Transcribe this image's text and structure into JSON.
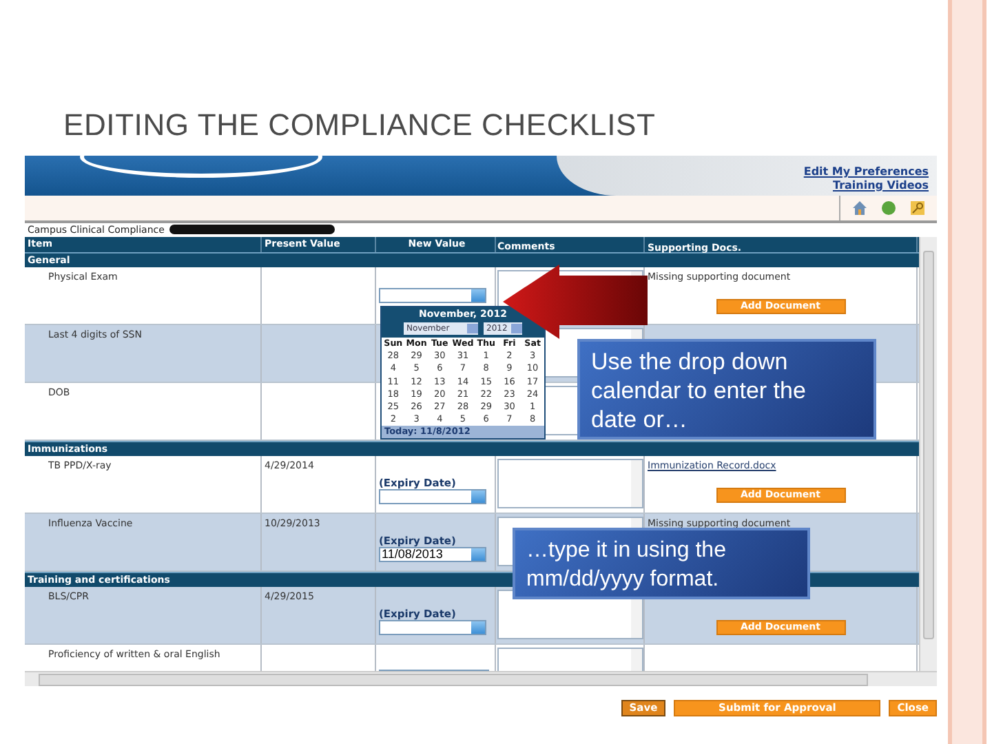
{
  "slide_title": "EDITING THE COMPLIANCE CHECKLIST",
  "header": {
    "links": [
      "Edit My Preferences",
      "Training Videos"
    ]
  },
  "breadcrumb": "Campus Clinical Compliance",
  "table": {
    "columns": [
      "Item",
      "Present Value",
      "New Value",
      "Comments",
      "Supporting Docs."
    ],
    "groups": [
      {
        "title": "General",
        "rows": [
          {
            "item": "Physical Exam",
            "shaded": false,
            "new_value": {
              "kind": "select"
            },
            "docs": {
              "kind": "note",
              "text": "Missing supporting document",
              "button": "Add Document"
            }
          },
          {
            "item": "Last 4 digits of SSN",
            "shaded": true
          },
          {
            "item": "DOB",
            "shaded": false
          }
        ]
      },
      {
        "title": "Immunizations",
        "rows": [
          {
            "item": "TB PPD/X-ray",
            "present": "4/29/2014",
            "shaded": false,
            "new_value": {
              "kind": "select",
              "label": "(Expiry Date)"
            },
            "docs": {
              "kind": "link",
              "text": "Immunization Record.docx",
              "button": "Add Document"
            }
          },
          {
            "item": "Influenza Vaccine",
            "present": "10/29/2013",
            "shaded": true,
            "new_value": {
              "kind": "select",
              "label": "(Expiry Date)",
              "value": "11/08/2013"
            },
            "docs": {
              "kind": "note",
              "text": "Missing supporting document"
            }
          }
        ]
      },
      {
        "title": "Training and certifications",
        "rows": [
          {
            "item": "BLS/CPR",
            "present": "4/29/2015",
            "shaded": true,
            "new_value": {
              "kind": "select",
              "label": "(Expiry Date)"
            },
            "docs": {
              "kind": "none",
              "button": "Add Document"
            }
          },
          {
            "item": "Proficiency of written & oral English",
            "shaded": false,
            "new_value": {
              "kind": "text"
            }
          }
        ]
      }
    ]
  },
  "calendar": {
    "title": "November, 2012",
    "month": "November",
    "year": "2012",
    "weekdays": [
      "Sun",
      "Mon",
      "Tue",
      "Wed",
      "Thu",
      "Fri",
      "Sat"
    ],
    "weeks": [
      [
        "28",
        "29",
        "30",
        "31",
        "1",
        "2",
        "3"
      ],
      [
        "4",
        "5",
        "6",
        "7",
        "8",
        "9",
        "10"
      ],
      [
        "11",
        "12",
        "13",
        "14",
        "15",
        "16",
        "17"
      ],
      [
        "18",
        "19",
        "20",
        "21",
        "22",
        "23",
        "24"
      ],
      [
        "25",
        "26",
        "27",
        "28",
        "29",
        "30",
        "1"
      ],
      [
        "2",
        "3",
        "4",
        "5",
        "6",
        "7",
        "8"
      ]
    ],
    "today": "Today: 11/8/2012"
  },
  "callouts": [
    "Use the drop down calendar to enter the date or…",
    "…type it in using the mm/dd/yyyy format."
  ],
  "buttons": [
    "Save",
    "Submit for Approval",
    "Close"
  ]
}
